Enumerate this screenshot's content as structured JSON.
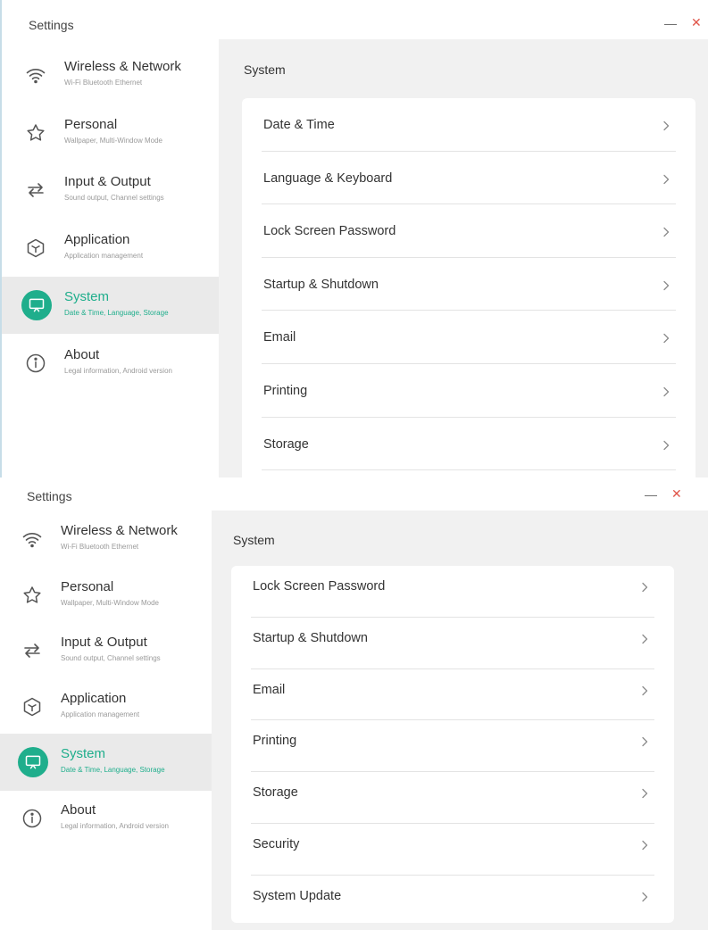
{
  "panels": [
    {
      "app_title": "Settings",
      "section_title": "System",
      "rows": [
        "Date & Time",
        "Language & Keyboard",
        "Lock Screen Password",
        "Startup & Shutdown",
        "Email",
        "Printing",
        "Storage"
      ]
    },
    {
      "app_title": "Settings",
      "section_title": "System",
      "rows": [
        "Lock Screen Password",
        "Startup & Shutdown",
        "Email",
        "Printing",
        "Storage",
        "Security",
        "System Update"
      ]
    }
  ],
  "window": {
    "minimize_glyph": "—",
    "close_glyph": "✕"
  },
  "sidebar": {
    "selected_index": 4,
    "items": [
      {
        "icon": "wifi-icon",
        "label": "Wireless & Network",
        "sub": "Wi-Fi Bluetooth Ethernet"
      },
      {
        "icon": "star-icon",
        "label": "Personal",
        "sub": "Wallpaper, Multi-Window Mode"
      },
      {
        "icon": "swap-arrows-icon",
        "label": "Input & Output",
        "sub": "Sound output, Channel settings"
      },
      {
        "icon": "cube-icon",
        "label": "Application",
        "sub": "Application management"
      },
      {
        "icon": "monitor-icon",
        "label": "System",
        "sub": "Date & Time, Language, Storage"
      },
      {
        "icon": "info-icon",
        "label": "About",
        "sub": "Legal information, Android version"
      }
    ]
  },
  "colors": {
    "accent": "#1fae8c",
    "close": "#e0554a",
    "main_bg": "#f1f1f1",
    "selected_bg": "#eaeaea"
  }
}
